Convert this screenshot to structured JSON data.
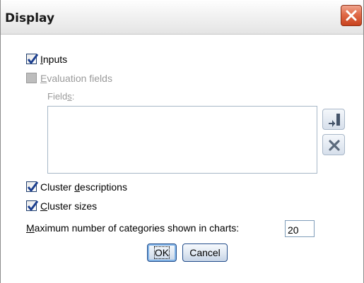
{
  "window": {
    "title": "Display"
  },
  "options": {
    "inputs": {
      "prefix": "",
      "mnemonic": "I",
      "rest": "nputs",
      "checked": true,
      "enabled": true
    },
    "evaluation_fields": {
      "prefix": "",
      "mnemonic": "E",
      "rest": "valuation fields",
      "checked": false,
      "enabled": false
    },
    "fields_label": {
      "prefix": "Field",
      "mnemonic": "s",
      "rest": ":"
    },
    "cluster_descriptions": {
      "prefix": "Cluster ",
      "mnemonic": "d",
      "rest": "escriptions",
      "checked": true,
      "enabled": true
    },
    "cluster_sizes": {
      "prefix": "",
      "mnemonic": "C",
      "rest": "luster sizes",
      "checked": true,
      "enabled": true
    },
    "max_categories": {
      "prefix": "",
      "mnemonic": "M",
      "rest": "aximum number of categories shown in charts:",
      "value": "20"
    }
  },
  "fields_list": {
    "items": [],
    "pick_icon": "field-picker-icon",
    "remove_icon": "delete-x-icon"
  },
  "buttons": {
    "ok": "OK",
    "cancel": "Cancel"
  },
  "colors": {
    "check": "#1c3f8f",
    "close_button": "#d4552e"
  }
}
